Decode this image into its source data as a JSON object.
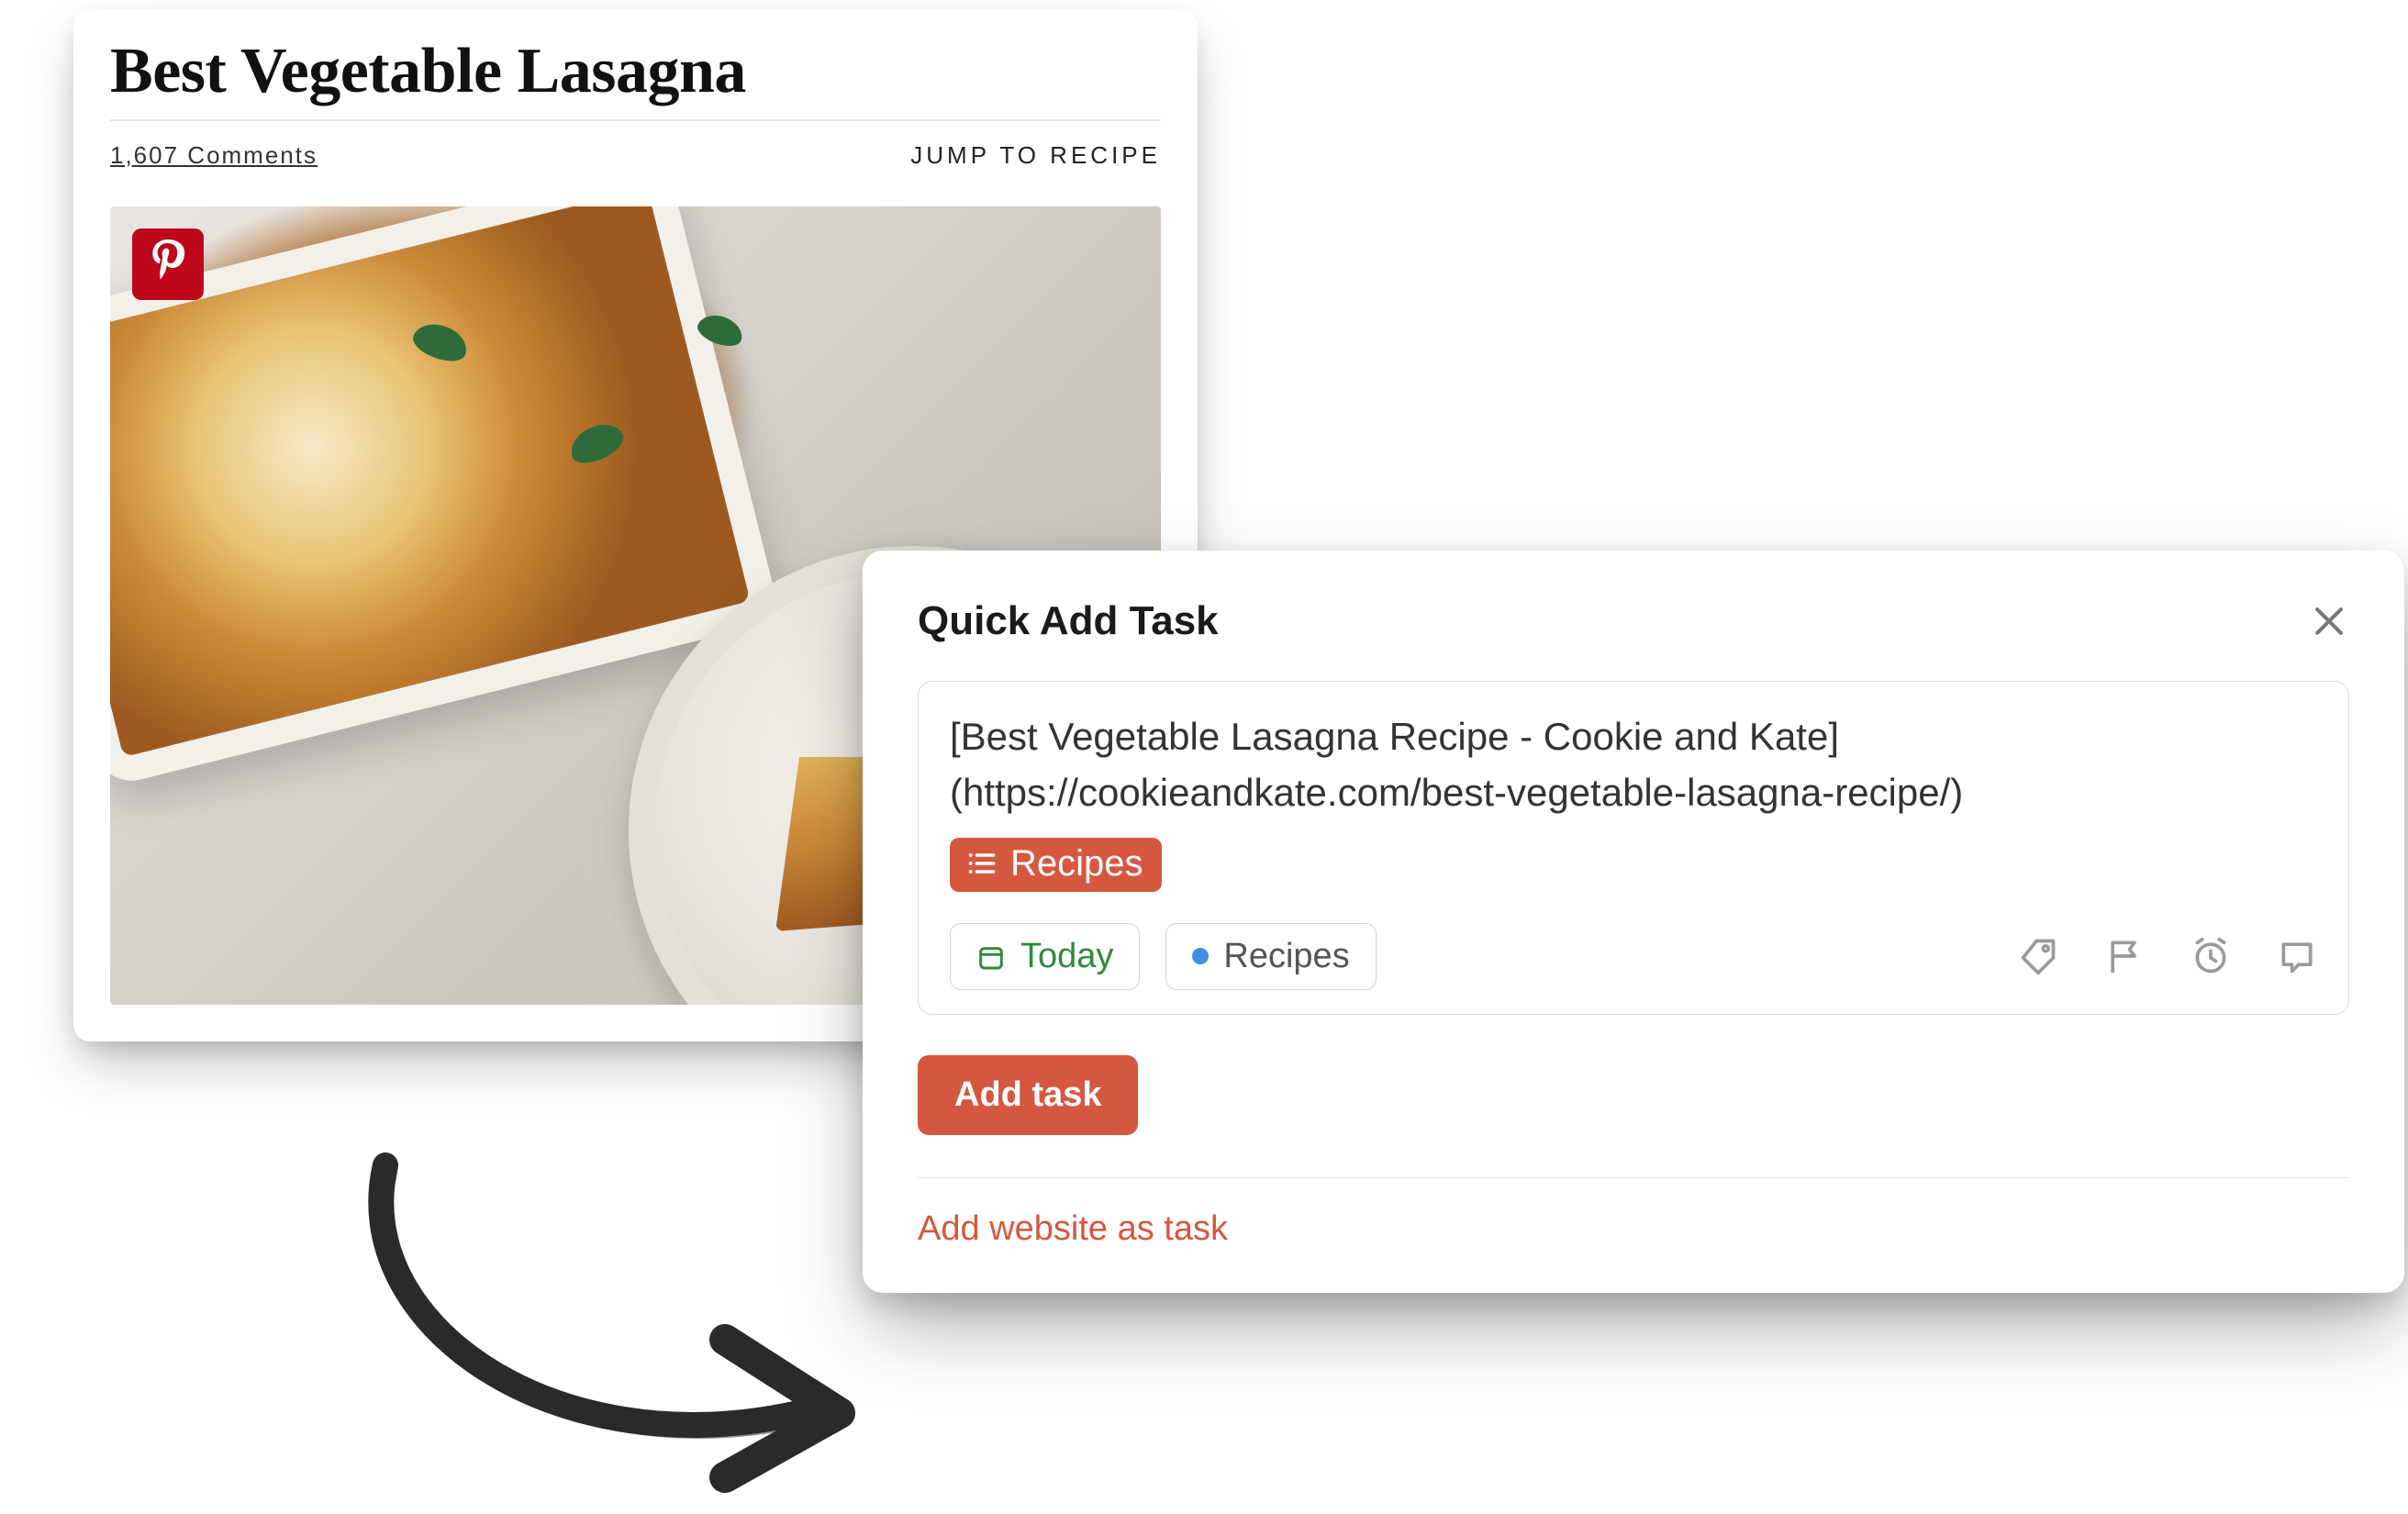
{
  "recipe": {
    "title": "Best Vegetable Lasagna",
    "comments_link": "1,607 Comments",
    "jump_link": "JUMP TO RECIPE",
    "pinterest_icon": "pinterest-icon"
  },
  "modal": {
    "title": "Quick Add Task",
    "task_text": "[Best Vegetable Lasagna Recipe - Cookie and Kate](https://cookieandkate.com/best-vegetable-lasagna-recipe/)",
    "project_chip": "Recipes",
    "date_chip": "Today",
    "project_select": "Recipes",
    "add_button": "Add task",
    "footer_link": "Add website as task"
  },
  "colors": {
    "accent": "#d6573f",
    "today_green": "#2f8a3b",
    "pinterest_red": "#bd081c",
    "project_dot": "#3d8fe6"
  }
}
